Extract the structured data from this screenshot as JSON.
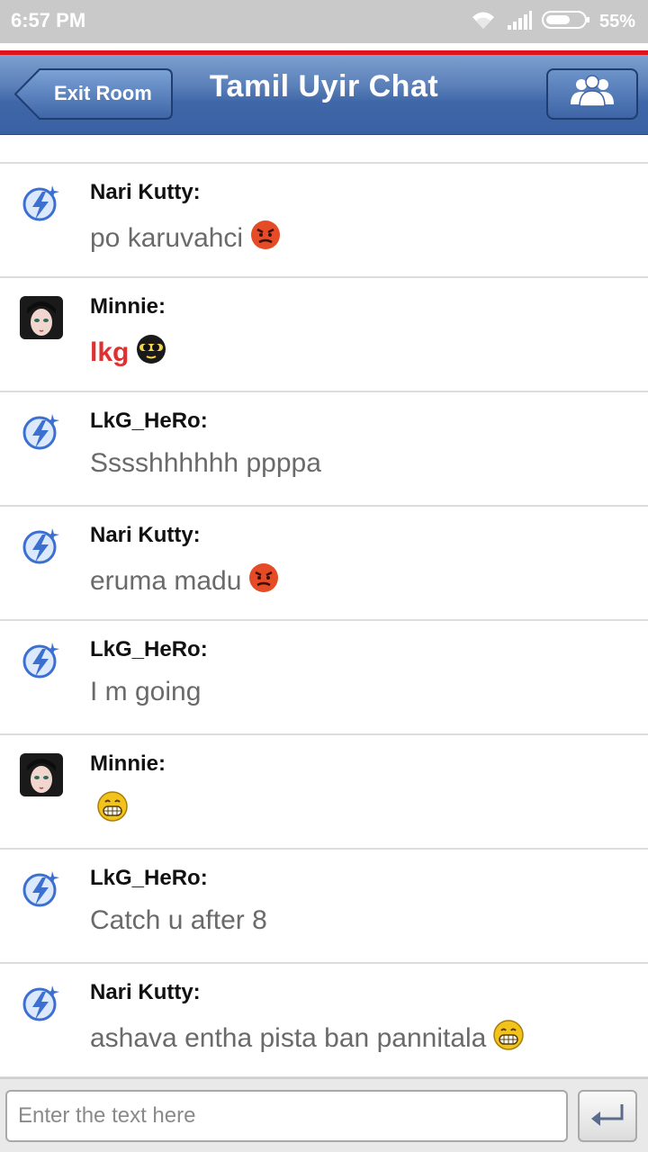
{
  "status_bar": {
    "time": "6:57 PM",
    "battery_percent": "55%"
  },
  "header": {
    "back_label": "Exit Room",
    "title": "Tamil Uyir Chat",
    "users_icon": "group-icon"
  },
  "messages": [
    {
      "user": "Nari Kutty:",
      "text": "po karuvahci",
      "avatar": "lightning-icon",
      "emoji": "angry-face",
      "style": "normal"
    },
    {
      "user": "Minnie:",
      "text": "lkg",
      "avatar": "anime-girl",
      "emoji": "sunglasses-face",
      "style": "red"
    },
    {
      "user": "LkG_HeRo:",
      "text": "Sssshhhhhh ppppa",
      "avatar": "lightning-icon",
      "emoji": "",
      "style": "normal"
    },
    {
      "user": "Nari Kutty:",
      "text": "eruma madu",
      "avatar": "lightning-icon",
      "emoji": "angry-face",
      "style": "normal"
    },
    {
      "user": "LkG_HeRo:",
      "text": "I m going",
      "avatar": "lightning-icon",
      "emoji": "",
      "style": "normal"
    },
    {
      "user": "Minnie:",
      "text": "",
      "avatar": "anime-girl",
      "emoji": "grinning-face",
      "style": "normal"
    },
    {
      "user": "LkG_HeRo:",
      "text": "Catch u after 8",
      "avatar": "lightning-icon",
      "emoji": "",
      "style": "normal"
    },
    {
      "user": "Nari Kutty:",
      "text": "ashava entha pista ban pannitala",
      "avatar": "lightning-icon",
      "emoji": "grinning-face",
      "style": "normal"
    }
  ],
  "input": {
    "placeholder": "Enter the text here",
    "value": ""
  },
  "colors": {
    "header_blue": "#3f67a8",
    "accent_red": "#e0121b",
    "status_bar": "#c9c9c9"
  }
}
